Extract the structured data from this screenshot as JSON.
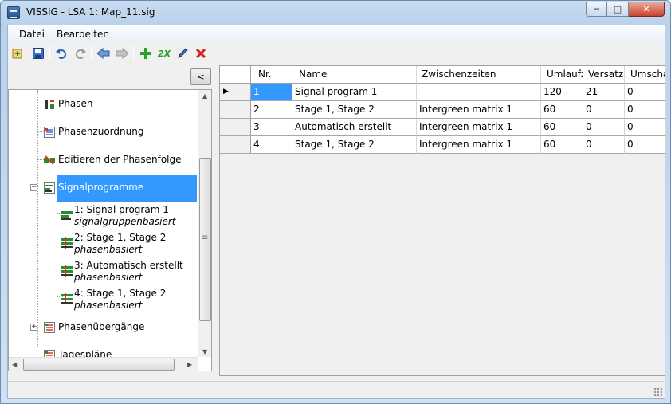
{
  "window": {
    "title": "VISSIG - LSA 1: Map_11.sig",
    "minimize_glyph": "─",
    "maximize_glyph": "□",
    "close_glyph": "✕"
  },
  "menu": {
    "items": [
      "Datei",
      "Bearbeiten"
    ]
  },
  "toolbar": {
    "icons": [
      "open-icon",
      "save-icon",
      "undo-icon",
      "redo-icon",
      "back-arrow-icon",
      "forward-arrow-icon",
      "add-icon",
      "duplicate-icon",
      "edit-pencil-icon",
      "delete-icon"
    ],
    "duplicate_text": "2X"
  },
  "left_pane": {
    "collapse_label": "<",
    "scroll_grip": "≡",
    "tree": [
      {
        "label": "Phasen",
        "icon": "phases-icon"
      },
      {
        "label": "Phasenzuordnung",
        "icon": "phase-assignment-icon"
      },
      {
        "label": "Editieren der Phasenfolge",
        "icon": "phase-sequence-icon"
      },
      {
        "label": "Signalprogramme",
        "icon": "signal-programs-icon",
        "selected": true,
        "expanded": true,
        "children": [
          {
            "label": "1: Signal program 1",
            "sub": "signalgruppenbasiert"
          },
          {
            "label": "2: Stage 1, Stage 2",
            "sub": "phasenbasiert"
          },
          {
            "label": "3: Automatisch erstellt",
            "sub": "phasenbasiert"
          },
          {
            "label": "4: Stage 1, Stage 2",
            "sub": "phasenbasiert"
          }
        ]
      },
      {
        "label": "Phasenübergänge",
        "icon": "phase-transitions-icon",
        "expander": "+"
      },
      {
        "label": "Tagespläne",
        "icon": "day-plans-icon"
      }
    ]
  },
  "grid": {
    "columns": [
      "Nr.",
      "Name",
      "Zwischenzeiten",
      "Umlaufz",
      "Versatz",
      "Umscha"
    ],
    "rows": [
      [
        "1",
        "Signal program 1",
        "",
        "120",
        "21",
        "0"
      ],
      [
        "2",
        "Stage 1, Stage 2",
        "Intergreen matrix 1",
        "60",
        "0",
        "0"
      ],
      [
        "3",
        "Automatisch erstellt",
        "Intergreen matrix 1",
        "60",
        "0",
        "0"
      ],
      [
        "4",
        "Stage 1, Stage 2",
        "Intergreen matrix 1",
        "60",
        "0",
        "0"
      ]
    ],
    "current_row_marker": "▶"
  },
  "colors": {
    "selection": "#3399ff",
    "add_green": "#2ca02c",
    "delete_red": "#d62020"
  }
}
